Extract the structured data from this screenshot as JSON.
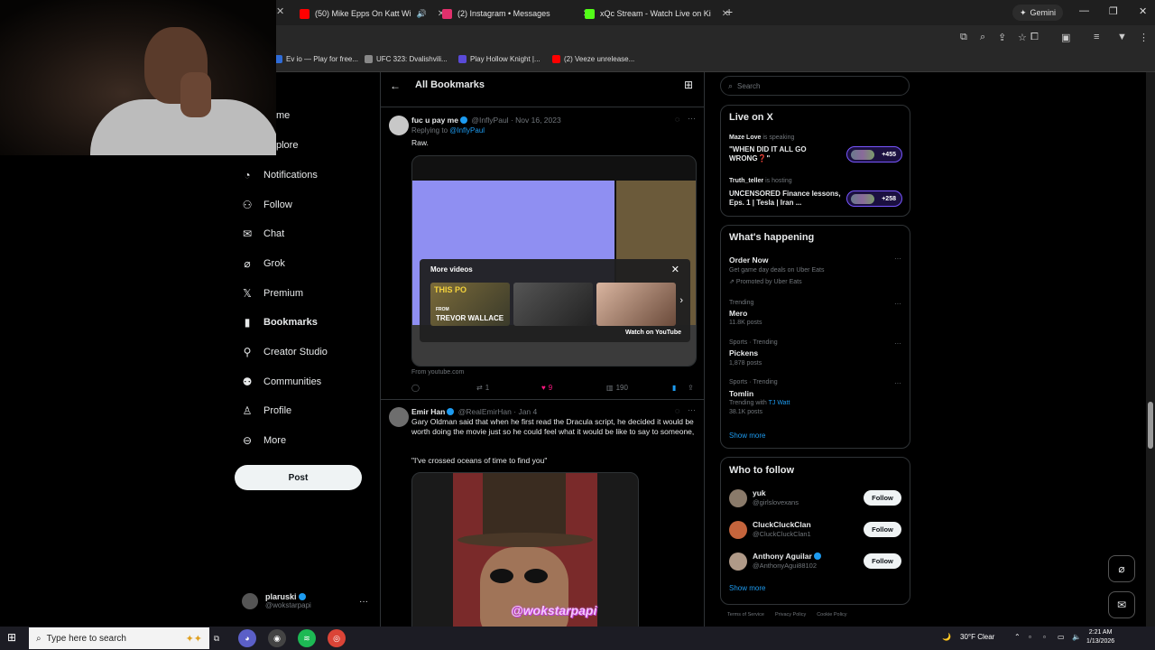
{
  "browser": {
    "tabs": [
      {
        "label": "(50) Mike Epps On Katt Wi",
        "favicon_color": "#ff0000"
      },
      {
        "label": "(2) Instagram • Messages",
        "favicon_color": "#e1306c"
      },
      {
        "label": "xQc Stream - Watch Live on Ki",
        "favicon_color": "#53fc18"
      }
    ],
    "gemini_label": "Gemini",
    "bookmarks": [
      {
        "label": "Ev io — Play for free...",
        "favicon_color": "#2f6cd8"
      },
      {
        "label": "UFC 323: Dvalishvili...",
        "favicon_color": "#888888"
      },
      {
        "label": "Play Hollow Knight |...",
        "favicon_color": "#5a4ad8"
      },
      {
        "label": "(2) Veeze unrelease...",
        "favicon_color": "#ff0000"
      }
    ]
  },
  "nav": {
    "home_partial": "me",
    "explore_partial": "plore",
    "items": [
      {
        "label": "Notifications",
        "icon": "bell-icon",
        "glyph": "🔔"
      },
      {
        "label": "Follow",
        "icon": "add-person-icon",
        "glyph": "☺"
      },
      {
        "label": "Chat",
        "icon": "mail-icon",
        "glyph": "✉"
      },
      {
        "label": "Grok",
        "icon": "grok-icon",
        "glyph": "⌀"
      },
      {
        "label": "Premium",
        "icon": "x-logo-icon",
        "glyph": "X"
      },
      {
        "label": "Bookmarks",
        "icon": "bookmark-icon",
        "glyph": "▮"
      },
      {
        "label": "Creator Studio",
        "icon": "creator-studio-icon",
        "glyph": "△"
      },
      {
        "label": "Communities",
        "icon": "communities-icon",
        "glyph": "☻"
      },
      {
        "label": "Profile",
        "icon": "profile-icon",
        "glyph": "☺"
      },
      {
        "label": "More",
        "icon": "more-circle-icon",
        "glyph": "⋯"
      }
    ],
    "post_label": "Post",
    "account": {
      "name": "plaruski",
      "handle": "@wokstarpapi"
    }
  },
  "main": {
    "title": "All Bookmarks",
    "tweet1": {
      "name": "fuc u pay me",
      "handle": "@InflyPaul",
      "date": "· Nov 16, 2023",
      "replying_prefix": "Replying to",
      "replying_to": "@InflyPaul",
      "text": "Raw.",
      "more_videos_label": "More videos",
      "thumb1_small": "FROM",
      "thumb1_title": "TREVOR WALLACE",
      "thumb1_banner": "THIS PO",
      "watch_on_youtube": "Watch on YouTube",
      "source": "From youtube.com",
      "retweets": "1",
      "likes": "9",
      "views": "190"
    },
    "tweet2": {
      "name": "Emir Han",
      "handle": "@RealEmirHan",
      "date": "· Jan 4",
      "text": "Gary Oldman said that when he first read the Dracula script, he decided it would be worth doing the movie just so he could feel what it would be like to say to someone,",
      "quote": "\"I've crossed oceans of time to find you\""
    },
    "watermark": "@wokstarpapi"
  },
  "sidebar": {
    "search_placeholder": "Search",
    "live": {
      "title": "Live on X",
      "spaces": [
        {
          "host": "Maze Love",
          "action": "is speaking",
          "title": "\"WHEN DID IT ALL GO WRONG❓\"",
          "count": "+455"
        },
        {
          "host": "Truth_teller",
          "action": "is hosting",
          "title": "UNCENSORED Finance lessons, Eps. 1 | Tesla | Iran ...",
          "count": "+258"
        }
      ]
    },
    "happening": {
      "title": "What's happening",
      "trends": [
        {
          "context": "Get game day deals on Uber Eats",
          "name": "Order Now",
          "sub": "Promoted by Uber Eats",
          "promoted": true
        },
        {
          "context": "Trending",
          "name": "Mero",
          "sub": "11.8K posts"
        },
        {
          "context": "Sports · Trending",
          "name": "Pickens",
          "sub": "1,878 posts"
        },
        {
          "context": "Sports · Trending",
          "name": "Tomlin",
          "sub_prefix": "Trending with",
          "sub_link": "TJ Watt",
          "sub": "38.1K posts"
        }
      ],
      "show_more": "Show more"
    },
    "who_to_follow": {
      "title": "Who to follow",
      "users": [
        {
          "name": "yuk",
          "handle": "@girlslovexans",
          "avatar_color": "#8a7a6a"
        },
        {
          "name": "CluckCluckClan",
          "handle": "@CluckCluckClan1",
          "avatar_color": "#c4643c"
        },
        {
          "name": "Anthony Aguilar",
          "handle": "@AnthonyAgui88102",
          "avatar_color": "#b09a88"
        }
      ],
      "follow_label": "Follow",
      "show_more": "Show more"
    },
    "footer": [
      "Terms of Service",
      "Privacy Policy",
      "Cookie Policy"
    ]
  },
  "taskbar": {
    "search_placeholder": "Type here to search",
    "weather": "30°F  Clear",
    "time": "2:21 AM",
    "date": "1/13/2026"
  }
}
